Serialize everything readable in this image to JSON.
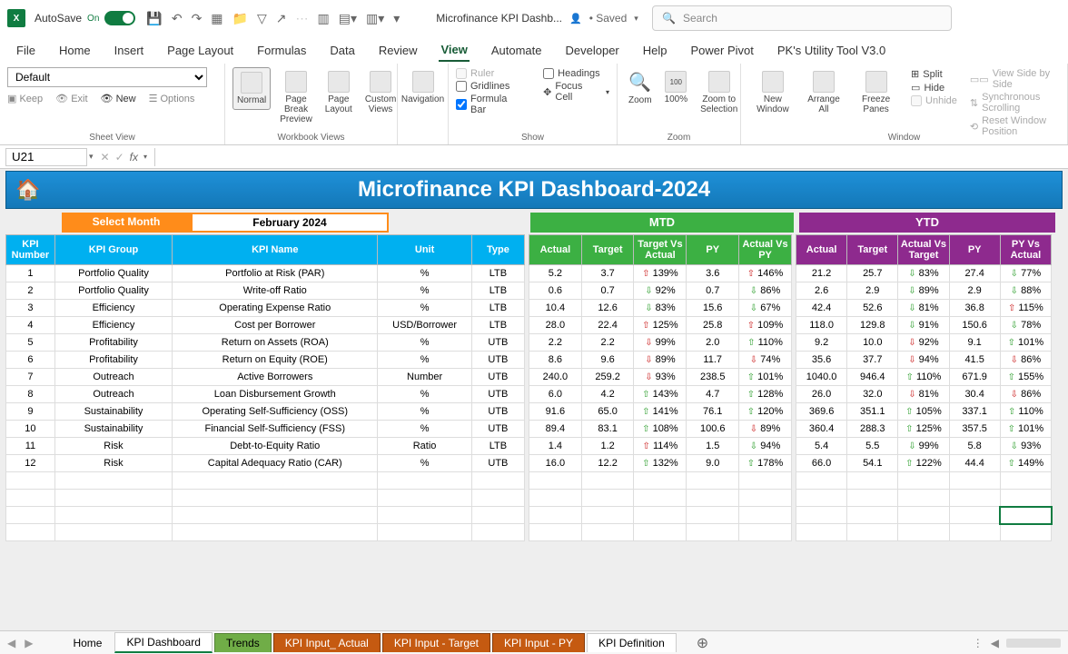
{
  "titlebar": {
    "autosave": "AutoSave",
    "doc": "Microfinance KPI Dashb...",
    "saved": "• Saved",
    "search_placeholder": "Search"
  },
  "menu": [
    "File",
    "Home",
    "Insert",
    "Page Layout",
    "Formulas",
    "Data",
    "Review",
    "View",
    "Automate",
    "Developer",
    "Help",
    "Power Pivot",
    "PK's Utility Tool V3.0"
  ],
  "menu_active": "View",
  "ribbon": {
    "sheet_view": {
      "default": "Default",
      "keep": "Keep",
      "exit": "Exit",
      "new": "New",
      "options": "Options",
      "label": "Sheet View"
    },
    "workbook_views": {
      "normal": "Normal",
      "pagebreak": "Page Break Preview",
      "pagelayout": "Page Layout",
      "custom": "Custom Views",
      "label": "Workbook Views"
    },
    "nav": "Navigation",
    "show": {
      "ruler": "Ruler",
      "gridlines": "Gridlines",
      "formula": "Formula Bar",
      "headings": "Headings",
      "focus": "Focus Cell",
      "label": "Show"
    },
    "zoom": {
      "zoom": "Zoom",
      "p100": "100%",
      "zts": "Zoom to Selection",
      "label": "Zoom"
    },
    "window": {
      "new": "New Window",
      "arrange": "Arrange All",
      "freeze": "Freeze Panes",
      "split": "Split",
      "hide": "Hide",
      "unhide": "Unhide",
      "sbs": "View Side by Side",
      "sync": "Synchronous Scrolling",
      "reset": "Reset Window Position",
      "label": "Window"
    }
  },
  "cell_ref": "U21",
  "dashboard": {
    "title": "Microfinance KPI Dashboard-2024",
    "select_month_label": "Select Month",
    "month": "February 2024",
    "mtd_label": "MTD",
    "ytd_label": "YTD",
    "left_headers": [
      "KPI Number",
      "KPI Group",
      "KPI Name",
      "Unit",
      "Type"
    ],
    "mtd_headers": [
      "Actual",
      "Target",
      "Target Vs Actual",
      "PY",
      "Actual Vs PY"
    ],
    "ytd_headers": [
      "Actual",
      "Target",
      "Actual Vs Target",
      "PY",
      "PY Vs Actual"
    ],
    "rows": [
      {
        "n": "1",
        "g": "Portfolio Quality",
        "k": "Portfolio at Risk (PAR)",
        "u": "%",
        "t": "LTB",
        "ma": "5.2",
        "mt": "3.7",
        "mtva": "139%",
        "mtva_d": "up-r",
        "mpy": "3.6",
        "mvpy": "146%",
        "mvpy_d": "up-r",
        "ya": "21.2",
        "yt": "25.7",
        "yvt": "83%",
        "yvt_d": "dn-g",
        "ypy": "27.4",
        "yvpy": "77%",
        "yvpy_d": "dn-g"
      },
      {
        "n": "2",
        "g": "Portfolio Quality",
        "k": "Write-off Ratio",
        "u": "%",
        "t": "LTB",
        "ma": "0.6",
        "mt": "0.7",
        "mtva": "92%",
        "mtva_d": "dn-g",
        "mpy": "0.7",
        "mvpy": "86%",
        "mvpy_d": "dn-g",
        "ya": "2.6",
        "yt": "2.9",
        "yvt": "89%",
        "yvt_d": "dn-g",
        "ypy": "2.9",
        "yvpy": "88%",
        "yvpy_d": "dn-g"
      },
      {
        "n": "3",
        "g": "Efficiency",
        "k": "Operating Expense Ratio",
        "u": "%",
        "t": "LTB",
        "ma": "10.4",
        "mt": "12.6",
        "mtva": "83%",
        "mtva_d": "dn-g",
        "mpy": "15.6",
        "mvpy": "67%",
        "mvpy_d": "dn-g",
        "ya": "42.4",
        "yt": "52.6",
        "yvt": "81%",
        "yvt_d": "dn-g",
        "ypy": "36.8",
        "yvpy": "115%",
        "yvpy_d": "up-r"
      },
      {
        "n": "4",
        "g": "Efficiency",
        "k": "Cost per Borrower",
        "u": "USD/Borrower",
        "t": "LTB",
        "ma": "28.0",
        "mt": "22.4",
        "mtva": "125%",
        "mtva_d": "up-r",
        "mpy": "25.8",
        "mvpy": "109%",
        "mvpy_d": "up-r",
        "ya": "118.0",
        "yt": "129.8",
        "yvt": "91%",
        "yvt_d": "dn-g",
        "ypy": "150.6",
        "yvpy": "78%",
        "yvpy_d": "dn-g"
      },
      {
        "n": "5",
        "g": "Profitability",
        "k": "Return on Assets (ROA)",
        "u": "%",
        "t": "UTB",
        "ma": "2.2",
        "mt": "2.2",
        "mtva": "99%",
        "mtva_d": "dn-r",
        "mpy": "2.0",
        "mvpy": "110%",
        "mvpy_d": "up-g",
        "ya": "9.2",
        "yt": "10.0",
        "yvt": "92%",
        "yvt_d": "dn-r",
        "ypy": "9.1",
        "yvpy": "101%",
        "yvpy_d": "up-g"
      },
      {
        "n": "6",
        "g": "Profitability",
        "k": "Return on Equity (ROE)",
        "u": "%",
        "t": "UTB",
        "ma": "8.6",
        "mt": "9.6",
        "mtva": "89%",
        "mtva_d": "dn-r",
        "mpy": "11.7",
        "mvpy": "74%",
        "mvpy_d": "dn-r",
        "ya": "35.6",
        "yt": "37.7",
        "yvt": "94%",
        "yvt_d": "dn-r",
        "ypy": "41.5",
        "yvpy": "86%",
        "yvpy_d": "dn-r"
      },
      {
        "n": "7",
        "g": "Outreach",
        "k": "Active Borrowers",
        "u": "Number",
        "t": "UTB",
        "ma": "240.0",
        "mt": "259.2",
        "mtva": "93%",
        "mtva_d": "dn-r",
        "mpy": "238.5",
        "mvpy": "101%",
        "mvpy_d": "up-g",
        "ya": "1040.0",
        "yt": "946.4",
        "yvt": "110%",
        "yvt_d": "up-g",
        "ypy": "671.9",
        "yvpy": "155%",
        "yvpy_d": "up-g"
      },
      {
        "n": "8",
        "g": "Outreach",
        "k": "Loan Disbursement Growth",
        "u": "%",
        "t": "UTB",
        "ma": "6.0",
        "mt": "4.2",
        "mtva": "143%",
        "mtva_d": "up-g",
        "mpy": "4.7",
        "mvpy": "128%",
        "mvpy_d": "up-g",
        "ya": "26.0",
        "yt": "32.0",
        "yvt": "81%",
        "yvt_d": "dn-r",
        "ypy": "30.4",
        "yvpy": "86%",
        "yvpy_d": "dn-r"
      },
      {
        "n": "9",
        "g": "Sustainability",
        "k": "Operating Self-Sufficiency (OSS)",
        "u": "%",
        "t": "UTB",
        "ma": "91.6",
        "mt": "65.0",
        "mtva": "141%",
        "mtva_d": "up-g",
        "mpy": "76.1",
        "mvpy": "120%",
        "mvpy_d": "up-g",
        "ya": "369.6",
        "yt": "351.1",
        "yvt": "105%",
        "yvt_d": "up-g",
        "ypy": "337.1",
        "yvpy": "110%",
        "yvpy_d": "up-g"
      },
      {
        "n": "10",
        "g": "Sustainability",
        "k": "Financial Self-Sufficiency (FSS)",
        "u": "%",
        "t": "UTB",
        "ma": "89.4",
        "mt": "83.1",
        "mtva": "108%",
        "mtva_d": "up-g",
        "mpy": "100.6",
        "mvpy": "89%",
        "mvpy_d": "dn-r",
        "ya": "360.4",
        "yt": "288.3",
        "yvt": "125%",
        "yvt_d": "up-g",
        "ypy": "357.5",
        "yvpy": "101%",
        "yvpy_d": "up-g"
      },
      {
        "n": "11",
        "g": "Risk",
        "k": "Debt-to-Equity Ratio",
        "u": "Ratio",
        "t": "LTB",
        "ma": "1.4",
        "mt": "1.2",
        "mtva": "114%",
        "mtva_d": "up-r",
        "mpy": "1.5",
        "mvpy": "94%",
        "mvpy_d": "dn-g",
        "ya": "5.4",
        "yt": "5.5",
        "yvt": "99%",
        "yvt_d": "dn-g",
        "ypy": "5.8",
        "yvpy": "93%",
        "yvpy_d": "dn-g"
      },
      {
        "n": "12",
        "g": "Risk",
        "k": "Capital Adequacy Ratio (CAR)",
        "u": "%",
        "t": "UTB",
        "ma": "16.0",
        "mt": "12.2",
        "mtva": "132%",
        "mtva_d": "up-g",
        "mpy": "9.0",
        "mvpy": "178%",
        "mvpy_d": "up-g",
        "ya": "66.0",
        "yt": "54.1",
        "yvt": "122%",
        "yvt_d": "up-g",
        "ypy": "44.4",
        "yvpy": "149%",
        "yvpy_d": "up-g"
      }
    ]
  },
  "tabs": [
    "Home",
    "KPI Dashboard",
    "Trends",
    "KPI Input_ Actual",
    "KPI Input - Target",
    "KPI Input - PY",
    "KPI Definition"
  ],
  "tabs_active": "KPI Dashboard"
}
